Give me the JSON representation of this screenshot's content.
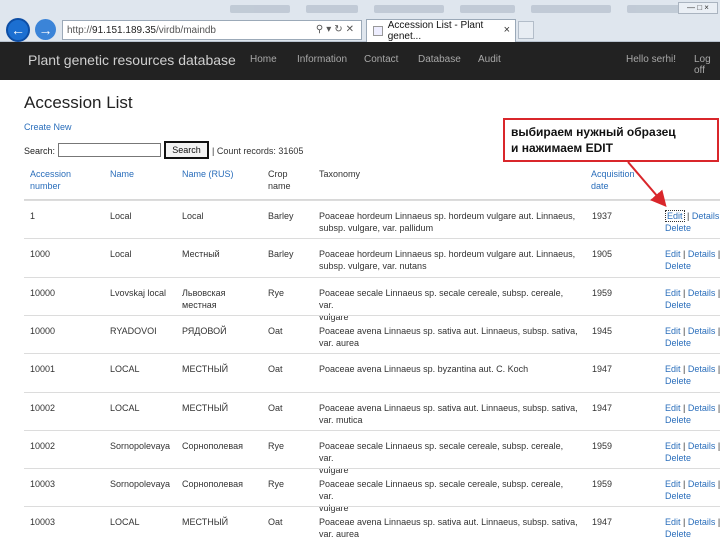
{
  "browser": {
    "url_prefix": "http://",
    "url_host": "91.151.189.35",
    "url_path": "/virdb/maindb",
    "tab_title": "Accession List - Plant genet...",
    "tools_label": "—  □  ×"
  },
  "navbar": {
    "brand": "Plant genetic resources database",
    "links": [
      "Home",
      "Information",
      "Contact",
      "Database",
      "Audit"
    ],
    "greeting": "Hello serhi!",
    "logout": "Log off"
  },
  "page": {
    "title": "Accession List",
    "create_new": "Create New",
    "search_label": "Search:",
    "search_value": "",
    "search_button": "Search",
    "count_text": "| Count records: 31605"
  },
  "table": {
    "headers": {
      "accession_number": [
        "Accession",
        "number"
      ],
      "name": "Name",
      "name_rus": "Name (RUS)",
      "crop_name": [
        "Crop",
        "name"
      ],
      "taxonomy": "Taxonomy",
      "acquisition_date": [
        "Acquisition",
        "date"
      ]
    },
    "action_labels": {
      "edit": "Edit",
      "details": "Details",
      "delete": "Delete",
      "separator": "|"
    },
    "rows": [
      {
        "number": "1",
        "name": "Local",
        "name_rus": "Local",
        "crop": "Barley",
        "taxonomy": [
          "Poaceae hordeum Linnaeus sp. hordeum vulgare aut. Linnaeus,",
          "subsp. vulgare, var. pallidum"
        ],
        "date": "1937"
      },
      {
        "number": "1000",
        "name": "Local",
        "name_rus": "Местный",
        "crop": "Barley",
        "taxonomy": [
          "Poaceae hordeum Linnaeus sp. hordeum vulgare aut. Linnaeus,",
          "subsp. vulgare, var. nutans"
        ],
        "date": "1905"
      },
      {
        "number": "10000",
        "name": "Lvovskaj local",
        "name_rus": [
          "Львовская",
          "местная"
        ],
        "crop": "Rye",
        "taxonomy": [
          "Poaceae secale Linnaeus sp. secale cereale, subsp. cereale, var.",
          "vulgare"
        ],
        "date": "1959"
      },
      {
        "number": "10000",
        "name": "RYADOVOI",
        "name_rus": "РЯДОВОЙ",
        "crop": "Oat",
        "taxonomy": [
          "Poaceae avena Linnaeus sp. sativa aut. Linnaeus, subsp. sativa,",
          "var. aurea"
        ],
        "date": "1945"
      },
      {
        "number": "10001",
        "name": "LOCAL",
        "name_rus": "МЕСТНЫЙ",
        "crop": "Oat",
        "taxonomy": [
          "Poaceae avena Linnaeus sp. byzantina aut. C. Koch"
        ],
        "date": "1947"
      },
      {
        "number": "10002",
        "name": "LOCAL",
        "name_rus": "МЕСТНЫЙ",
        "crop": "Oat",
        "taxonomy": [
          "Poaceae avena Linnaeus sp. sativa aut. Linnaeus, subsp. sativa,",
          "var. mutica"
        ],
        "date": "1947"
      },
      {
        "number": "10002",
        "name": "Sornopolevaya",
        "name_rus": "Сорнополевая",
        "crop": "Rye",
        "taxonomy": [
          "Poaceae secale Linnaeus sp. secale cereale, subsp. cereale, var.",
          "vulgare"
        ],
        "date": "1959"
      },
      {
        "number": "10003",
        "name": "Sornopolevaya",
        "name_rus": "Сорнополевая",
        "crop": "Rye",
        "taxonomy": [
          "Poaceae secale Linnaeus sp. secale cereale, subsp. cereale, var.",
          "vulgare"
        ],
        "date": "1959"
      },
      {
        "number": "10003",
        "name": "LOCAL",
        "name_rus": "МЕСТНЫЙ",
        "crop": "Oat",
        "taxonomy": [
          "Poaceae avena Linnaeus sp. sativa aut. Linnaeus, subsp. sativa,",
          "var. aurea"
        ],
        "date": "1947"
      }
    ]
  },
  "annotation": {
    "line1": "выбираем нужный образец",
    "line2": "и нажимаем EDIT",
    "color": "#d9262b"
  }
}
